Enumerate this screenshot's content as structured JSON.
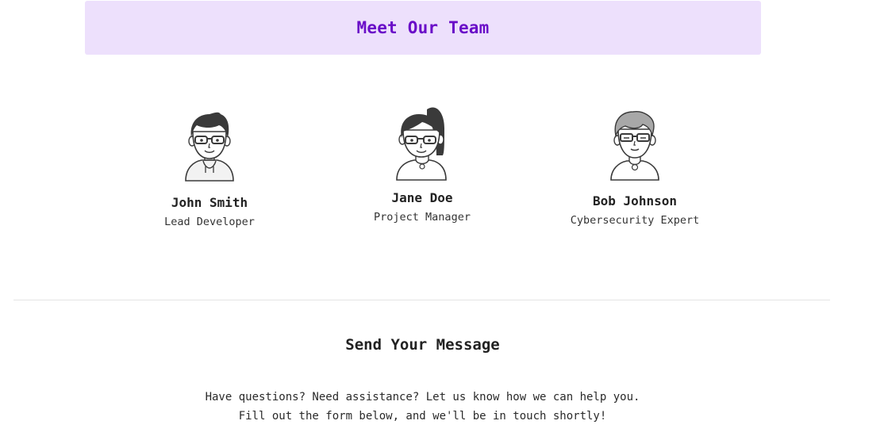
{
  "team": {
    "title": "Meet Our Team",
    "members": [
      {
        "name": "John Smith",
        "role": "Lead Developer",
        "avatar_icon": "man-glasses-avatar-icon"
      },
      {
        "name": "Jane Doe",
        "role": "Project Manager",
        "avatar_icon": "woman-ponytail-glasses-avatar-icon"
      },
      {
        "name": "Bob Johnson",
        "role": "Cybersecurity Expert",
        "avatar_icon": "older-man-glasses-avatar-icon"
      }
    ]
  },
  "contact": {
    "title": "Send Your Message",
    "intro_line1": "Have questions? Need assistance? Let us know how we can help you.",
    "intro_line2": "Fill out the form below, and we'll be in touch shortly!"
  },
  "colors": {
    "banner_bg": "#ede0fc",
    "banner_text": "#6a0dc8",
    "avatar_stroke": "#3a3a3a",
    "avatar_hair_dark": "#3a3a3a",
    "avatar_hair_gray": "#a8a8a8"
  }
}
